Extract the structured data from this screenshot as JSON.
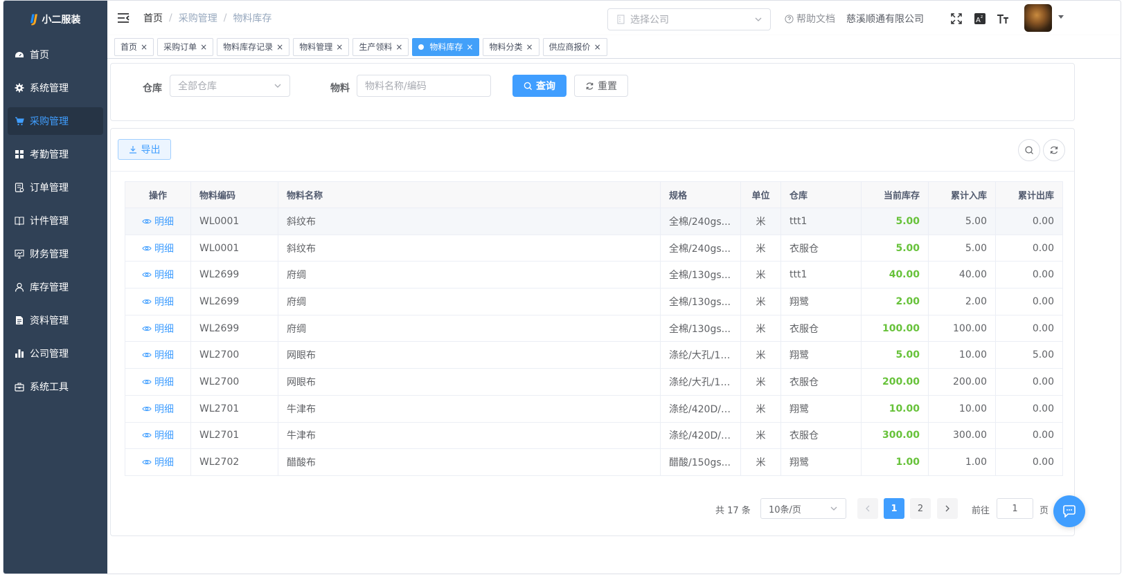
{
  "app": {
    "logo_text": "小二服装",
    "logo_mark": "IJ"
  },
  "sidebar": {
    "items": [
      {
        "label": "首页",
        "icon": "dashboard-icon",
        "active": false
      },
      {
        "label": "系统管理",
        "icon": "gear-icon",
        "active": false
      },
      {
        "label": "采购管理",
        "icon": "cart-icon",
        "active": true
      },
      {
        "label": "考勤管理",
        "icon": "grid-icon",
        "active": false
      },
      {
        "label": "订单管理",
        "icon": "order-icon",
        "active": false
      },
      {
        "label": "计件管理",
        "icon": "book-icon",
        "active": false
      },
      {
        "label": "财务管理",
        "icon": "monitor-icon",
        "active": false
      },
      {
        "label": "库存管理",
        "icon": "user-icon",
        "active": false
      },
      {
        "label": "资料管理",
        "icon": "document-icon",
        "active": false
      },
      {
        "label": "公司管理",
        "icon": "bar-chart-icon",
        "active": false
      },
      {
        "label": "系统工具",
        "icon": "toolbox-icon",
        "active": false
      }
    ]
  },
  "header": {
    "breadcrumb": [
      "首页",
      "采购管理",
      "物料库存"
    ],
    "company_select_placeholder": "选择公司",
    "help_label": "帮助文档",
    "company_name": "慈溪顺通有限公司"
  },
  "tags": [
    {
      "label": "首页",
      "active": false
    },
    {
      "label": "采购订单",
      "active": false
    },
    {
      "label": "物料库存记录",
      "active": false
    },
    {
      "label": "物料管理",
      "active": false
    },
    {
      "label": "生产领料",
      "active": false
    },
    {
      "label": "物料库存",
      "active": true
    },
    {
      "label": "物料分类",
      "active": false
    },
    {
      "label": "供应商报价",
      "active": false
    }
  ],
  "search": {
    "warehouse_label": "仓库",
    "warehouse_placeholder": "全部仓库",
    "material_label": "物料",
    "material_placeholder": "物料名称/编码",
    "query_label": "查询",
    "reset_label": "重置"
  },
  "toolbar": {
    "export_label": "导出"
  },
  "table": {
    "columns": [
      "操作",
      "物料编码",
      "物料名称",
      "规格",
      "单位",
      "仓库",
      "当前库存",
      "累计入库",
      "累计出库"
    ],
    "detail_label": "明细",
    "rows": [
      [
        "WL0001",
        "斜纹布",
        "全棉/240gs...",
        "米",
        "ttt1",
        "5.00",
        "5.00",
        "0.00"
      ],
      [
        "WL0001",
        "斜纹布",
        "全棉/240gs...",
        "米",
        "衣服仓",
        "5.00",
        "5.00",
        "0.00"
      ],
      [
        "WL2699",
        "府绸",
        "全棉/130gs...",
        "米",
        "ttt1",
        "40.00",
        "40.00",
        "0.00"
      ],
      [
        "WL2699",
        "府绸",
        "全棉/130gs...",
        "米",
        "翔鹭",
        "2.00",
        "2.00",
        "0.00"
      ],
      [
        "WL2699",
        "府绸",
        "全棉/130gs...",
        "米",
        "衣服仓",
        "100.00",
        "100.00",
        "0.00"
      ],
      [
        "WL2700",
        "网眼布",
        "涤纶/大孔/15...",
        "米",
        "翔鹭",
        "5.00",
        "10.00",
        "5.00"
      ],
      [
        "WL2700",
        "网眼布",
        "涤纶/大孔/15...",
        "米",
        "衣服仓",
        "200.00",
        "200.00",
        "0.00"
      ],
      [
        "WL2701",
        "牛津布",
        "涤纶/420D/1...",
        "米",
        "翔鹭",
        "10.00",
        "10.00",
        "0.00"
      ],
      [
        "WL2701",
        "牛津布",
        "涤纶/420D/1...",
        "米",
        "衣服仓",
        "300.00",
        "300.00",
        "0.00"
      ],
      [
        "WL2702",
        "醋酸布",
        "醋酸/150gs...",
        "米",
        "翔鹭",
        "1.00",
        "1.00",
        "0.00"
      ]
    ]
  },
  "pagination": {
    "total_text": "共 17 条",
    "page_size": "10条/页",
    "pages": [
      "1",
      "2"
    ],
    "current_page": "1",
    "goto_label": "前往",
    "goto_value": "1",
    "page_suffix": "页"
  },
  "colors": {
    "primary": "#409eff",
    "sidebar_bg": "#304156",
    "stock_green": "#67c23a"
  }
}
